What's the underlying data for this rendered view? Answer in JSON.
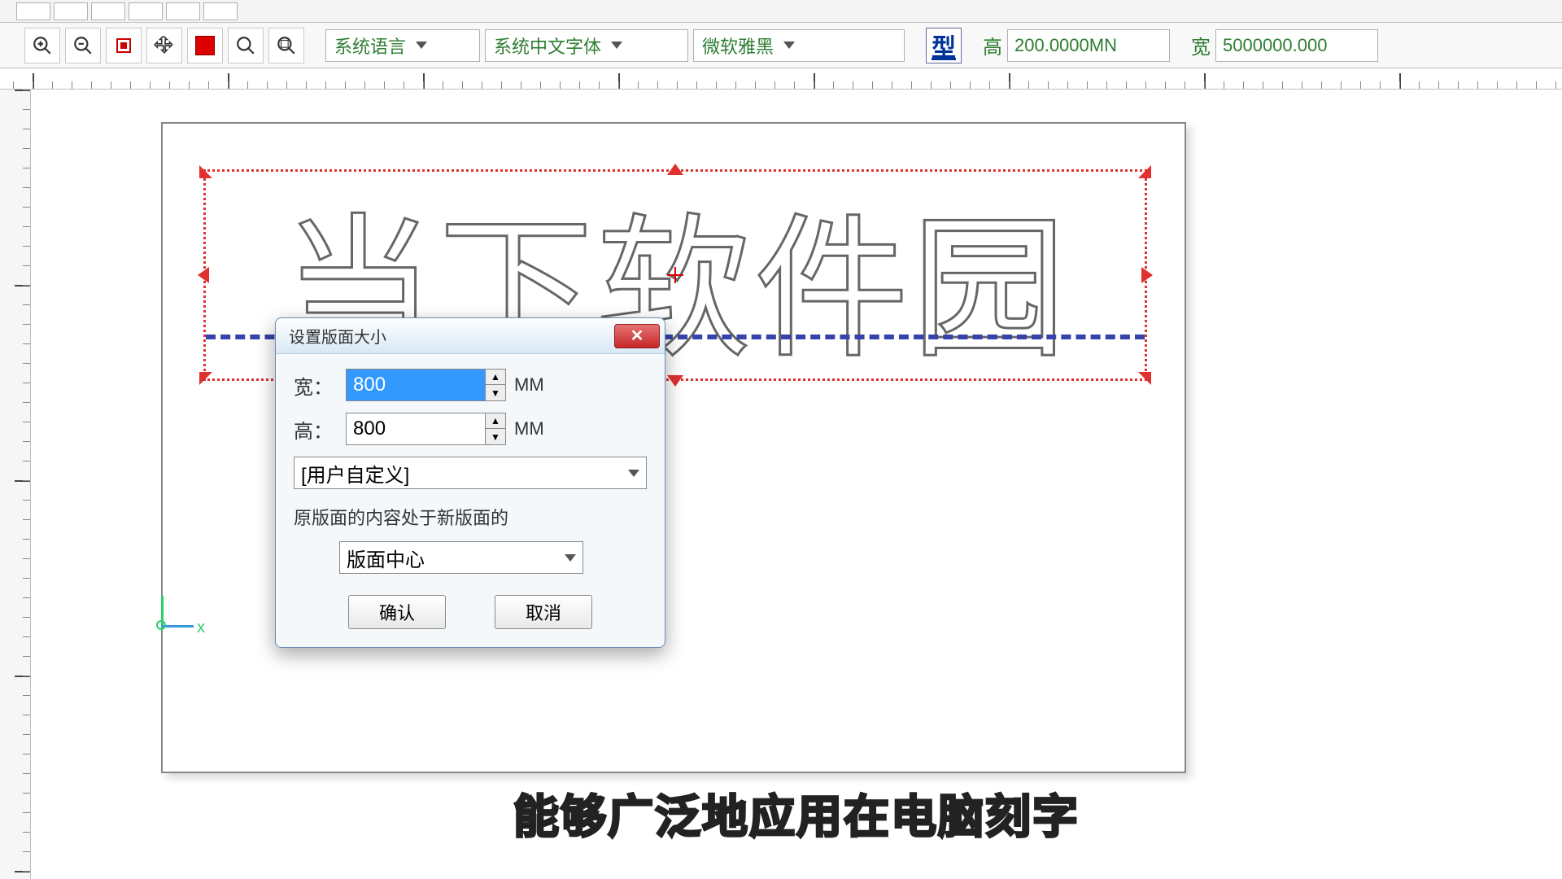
{
  "toolbar": {
    "lang_combo": "系统语言",
    "font_combo": "系统中文字体",
    "font2_combo": "微软雅黑",
    "type_btn": "型",
    "height_label": "高",
    "height_value": "200.0000MN",
    "width_label": "宽",
    "width_value": "5000000.000"
  },
  "canvas": {
    "outline_text": "当下软件园",
    "origin_x": "x"
  },
  "dialog": {
    "title": "设置版面大小",
    "width_label": "宽：",
    "width_value": "800",
    "height_label": "高：",
    "height_value": "800",
    "unit": "MM",
    "preset": "[用户自定义]",
    "note": "原版面的内容处于新版面的",
    "anchor": "版面中心",
    "ok": "确认",
    "cancel": "取消"
  },
  "subtitle": "能够广泛地应用在电脑刻字"
}
